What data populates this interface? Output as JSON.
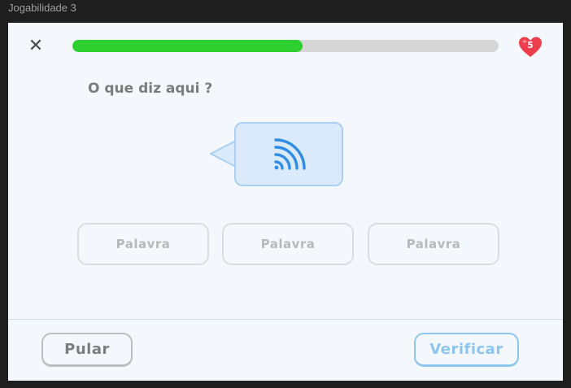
{
  "frame": {
    "title": "Jogabilidade 3"
  },
  "header": {
    "close_icon": "close-icon",
    "progress": 0.54,
    "progress_color": "#2dd02f",
    "lives": "5",
    "heart_color": "#ee3d4b"
  },
  "exercise": {
    "prompt": "O que diz aqui ?",
    "audio_icon": "sound-wave-icon",
    "words": [
      "Palavra",
      "Palavra",
      "Palavra"
    ]
  },
  "footer": {
    "skip_label": "Pular",
    "check_label": "Verificar",
    "accent": "#8cc6f0"
  }
}
